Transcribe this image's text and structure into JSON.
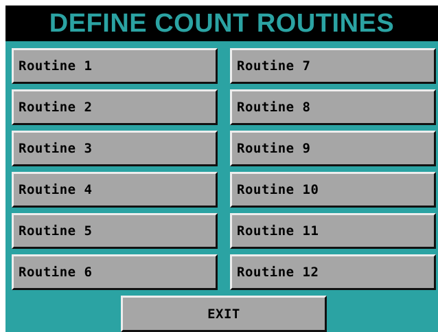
{
  "title": "DEFINE COUNT ROUTINES",
  "routines": [
    "Routine 1",
    "Routine 2",
    "Routine 3",
    "Routine 4",
    "Routine 5",
    "Routine 6",
    "Routine 7",
    "Routine 8",
    "Routine 9",
    "Routine 10",
    "Routine 11",
    "Routine 12"
  ],
  "exit_label": "EXIT",
  "colors": {
    "background": "#2ba3a3",
    "title_bar": "#000000",
    "title_text": "#2ba3a3",
    "button_face": "#a6a6a6",
    "button_text": "#000000"
  }
}
